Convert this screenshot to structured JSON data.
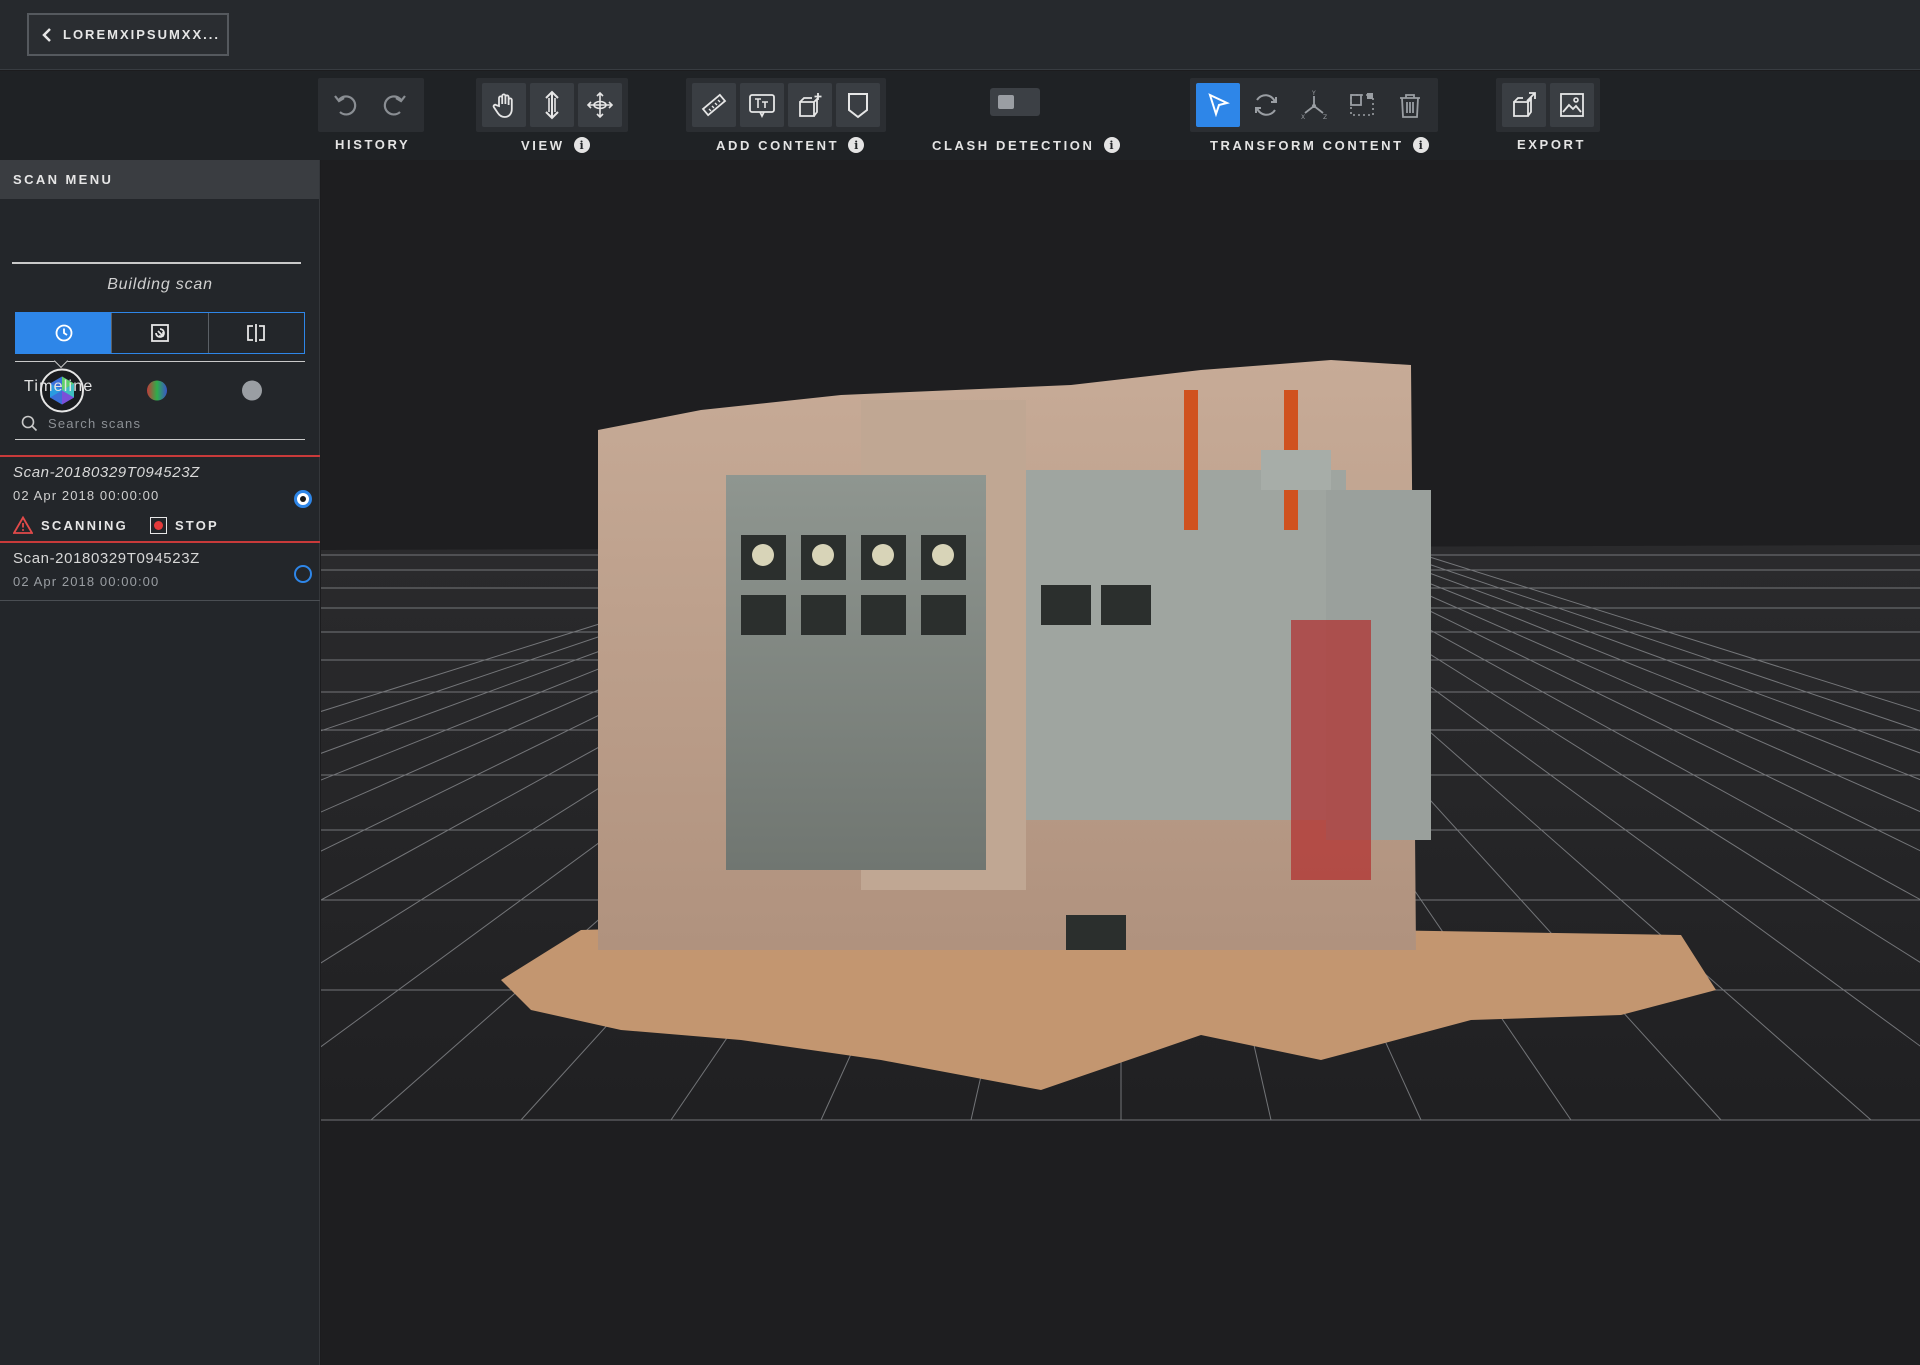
{
  "topbar": {
    "back_label": "LOREMXIPSUMXX..."
  },
  "toolbar": {
    "history_label": "HISTORY",
    "view_label": "VIEW",
    "add_content_label": "ADD CONTENT",
    "clash_label": "CLASH DETECTION",
    "transform_label": "TRANSFORM CONTENT",
    "export_label": "EXPORT",
    "icons": {
      "history": [
        "undo-icon",
        "redo-icon"
      ],
      "view": [
        "pan-hand-icon",
        "vertical-move-icon",
        "orbit-icon"
      ],
      "add_content": [
        "ruler-icon",
        "text-note-icon",
        "add-object-icon",
        "tag-icon"
      ],
      "transform": [
        "select-pointer-icon",
        "rotate-icon",
        "axis-icon",
        "scale-bounds-icon",
        "delete-trash-icon"
      ],
      "export": [
        "export-3d-icon",
        "export-image-icon"
      ]
    },
    "clash_enabled": false
  },
  "sidebar": {
    "title": "SCAN MENU",
    "modes": [
      "scan-mesh-icon",
      "color-map-icon",
      "solid-shading-icon"
    ],
    "mode_caption": "Building scan",
    "segments": [
      "timeline-clock-icon",
      "compare-overlay-icon",
      "split-view-icon"
    ],
    "active_segment": "Timeline",
    "search_placeholder": "Search scans",
    "scans": [
      {
        "name": "Scan-20180329T094523Z",
        "date": "02 Apr 2018 00:00:00",
        "status": "SCANNING",
        "stop": "STOP",
        "selected": true
      },
      {
        "name": "Scan-20180329T094523Z",
        "date": "02 Apr 2018 00:00:00",
        "selected": false
      }
    ]
  },
  "colors": {
    "accent": "#2e86e8",
    "alert": "#c93a3a",
    "panel": "#23262a"
  }
}
